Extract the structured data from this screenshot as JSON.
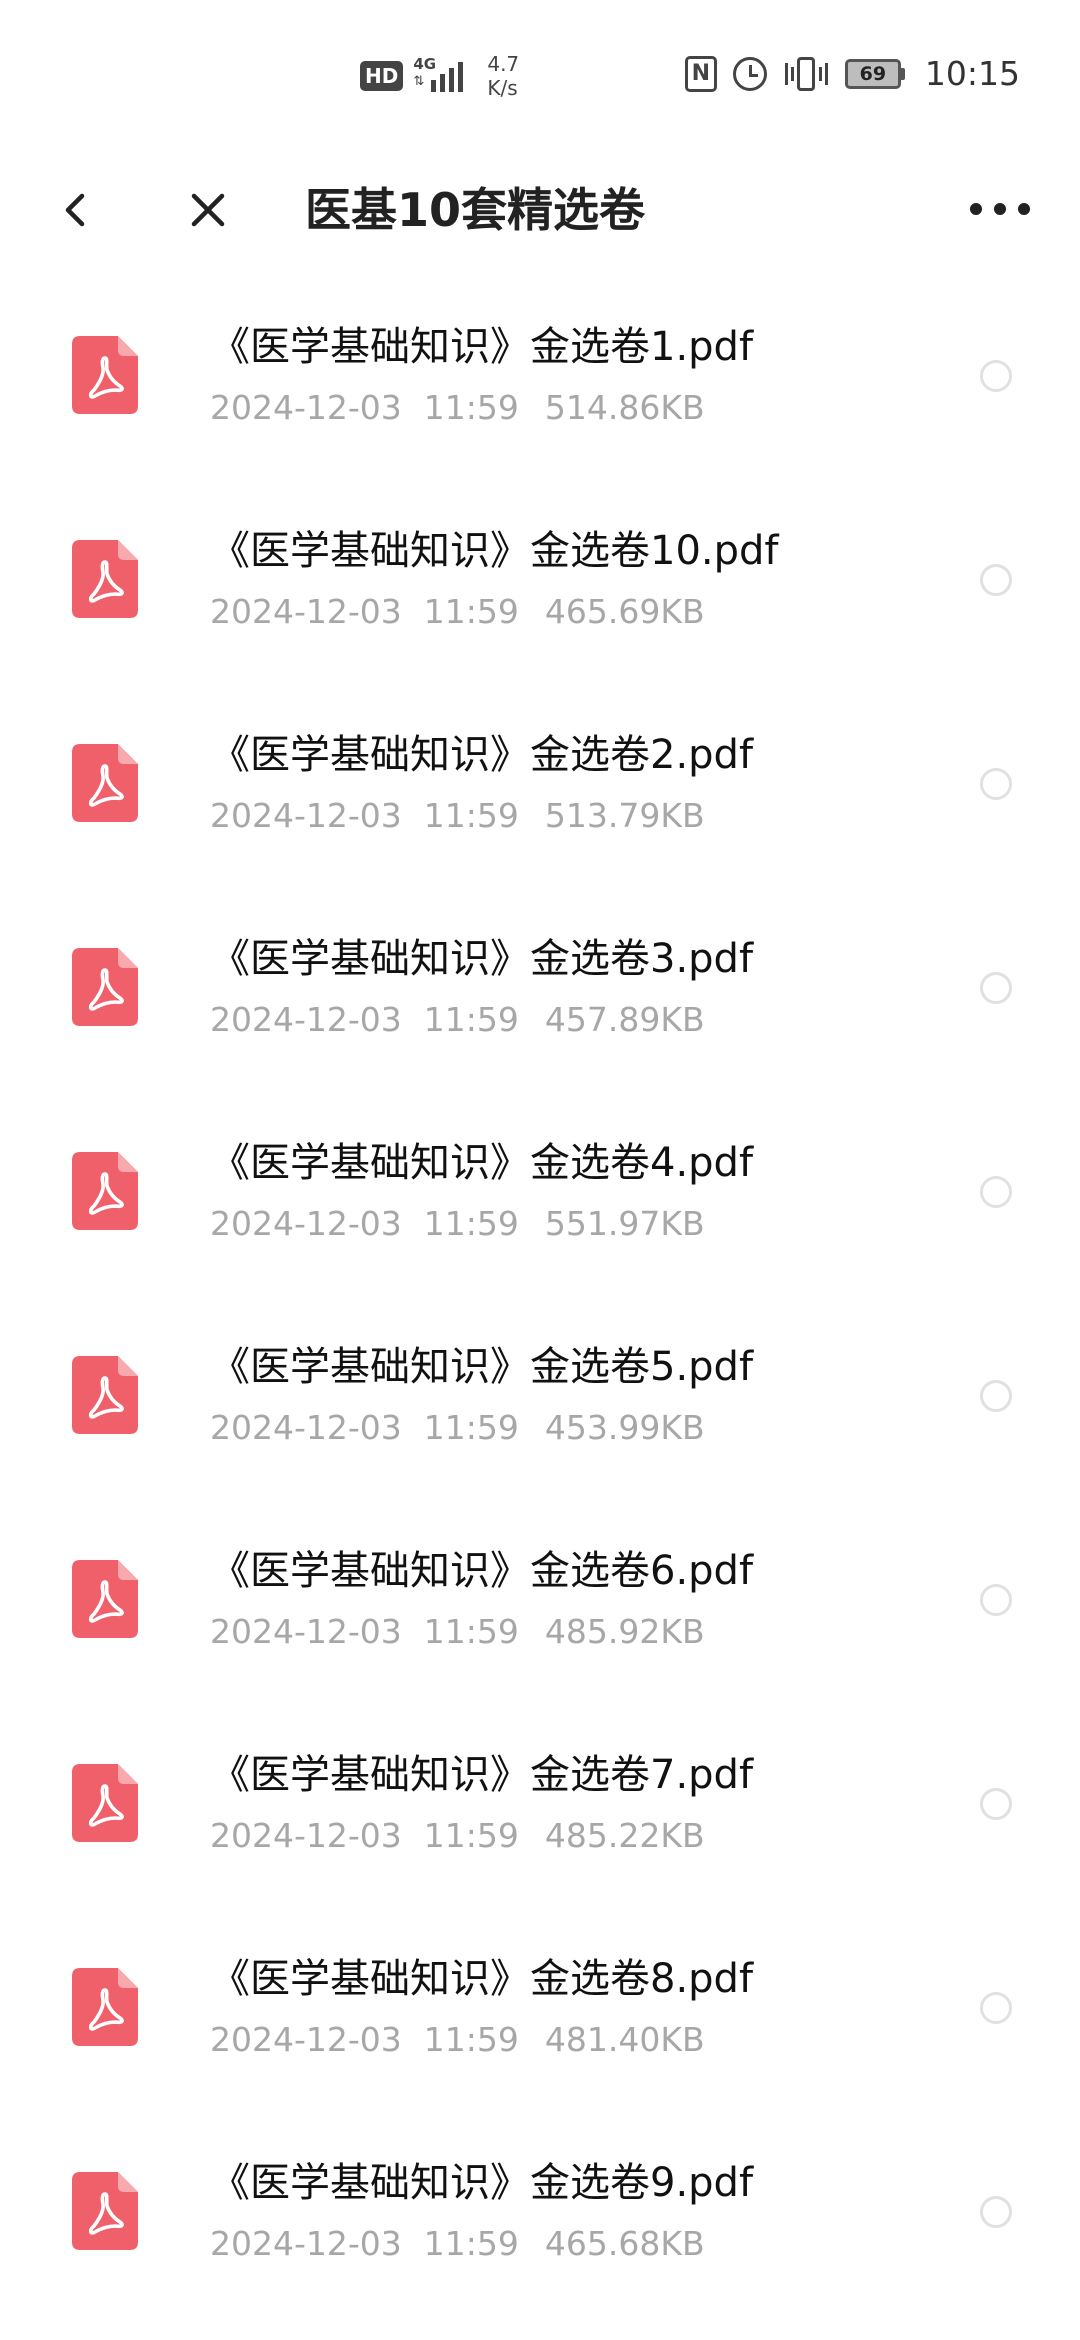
{
  "status_bar": {
    "hd_label": "HD",
    "network_label": "4G",
    "net_speed_value": "4.7",
    "net_speed_unit": "K/s",
    "nfc_label": "N",
    "battery_level": "69",
    "time": "10:15"
  },
  "title_bar": {
    "title": "医基10套精选卷"
  },
  "files": [
    {
      "name": "《医学基础知识》金选卷1.pdf",
      "date": "2024-12-03",
      "time": "11:59",
      "size": "514.86KB"
    },
    {
      "name": "《医学基础知识》金选卷10.pdf",
      "date": "2024-12-03",
      "time": "11:59",
      "size": "465.69KB"
    },
    {
      "name": "《医学基础知识》金选卷2.pdf",
      "date": "2024-12-03",
      "time": "11:59",
      "size": "513.79KB"
    },
    {
      "name": "《医学基础知识》金选卷3.pdf",
      "date": "2024-12-03",
      "time": "11:59",
      "size": "457.89KB"
    },
    {
      "name": "《医学基础知识》金选卷4.pdf",
      "date": "2024-12-03",
      "time": "11:59",
      "size": "551.97KB"
    },
    {
      "name": "《医学基础知识》金选卷5.pdf",
      "date": "2024-12-03",
      "time": "11:59",
      "size": "453.99KB"
    },
    {
      "name": "《医学基础知识》金选卷6.pdf",
      "date": "2024-12-03",
      "time": "11:59",
      "size": "485.92KB"
    },
    {
      "name": "《医学基础知识》金选卷7.pdf",
      "date": "2024-12-03",
      "time": "11:59",
      "size": "485.22KB"
    },
    {
      "name": "《医学基础知识》金选卷8.pdf",
      "date": "2024-12-03",
      "time": "11:59",
      "size": "481.40KB"
    },
    {
      "name": "《医学基础知识》金选卷9.pdf",
      "date": "2024-12-03",
      "time": "11:59",
      "size": "465.68KB"
    }
  ],
  "icons": {
    "file_type": "pdf-file-icon",
    "back": "chevron-left-icon",
    "close": "close-icon",
    "more": "more-horizontal-icon"
  },
  "colors": {
    "pdf_icon": "#f0606b",
    "meta_text": "#a7a7a7",
    "radio_border": "#e1e1e1"
  }
}
